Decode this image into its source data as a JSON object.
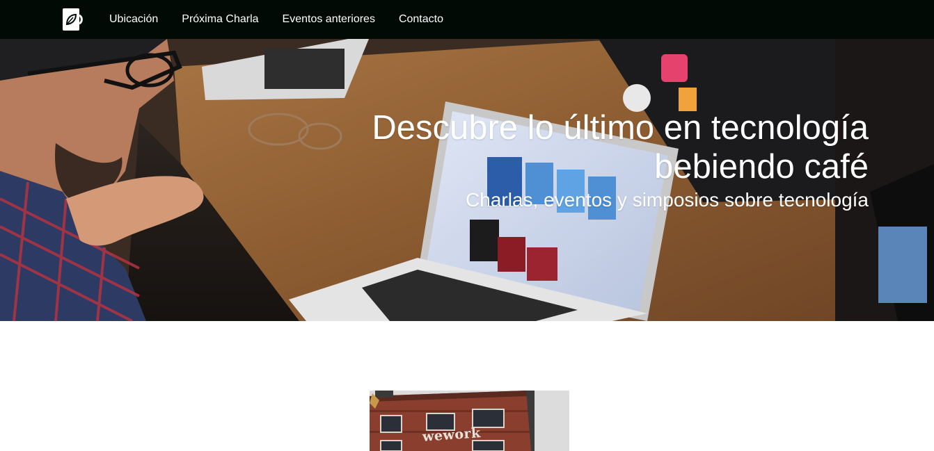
{
  "navbar": {
    "logo_icon": "coffee-cup-leaf-icon",
    "links": [
      {
        "label": "Ubicación"
      },
      {
        "label": "Próxima Charla"
      },
      {
        "label": "Eventos anteriores"
      },
      {
        "label": "Contacto"
      }
    ],
    "background_color": "#020a06"
  },
  "hero": {
    "title_line1": "Descubre lo último en tecnología",
    "title_line2": "bebiendo café",
    "subtitle": "Charlas, eventos y simposios sobre tecnología"
  },
  "location": {
    "image_sign_text": "wework"
  }
}
